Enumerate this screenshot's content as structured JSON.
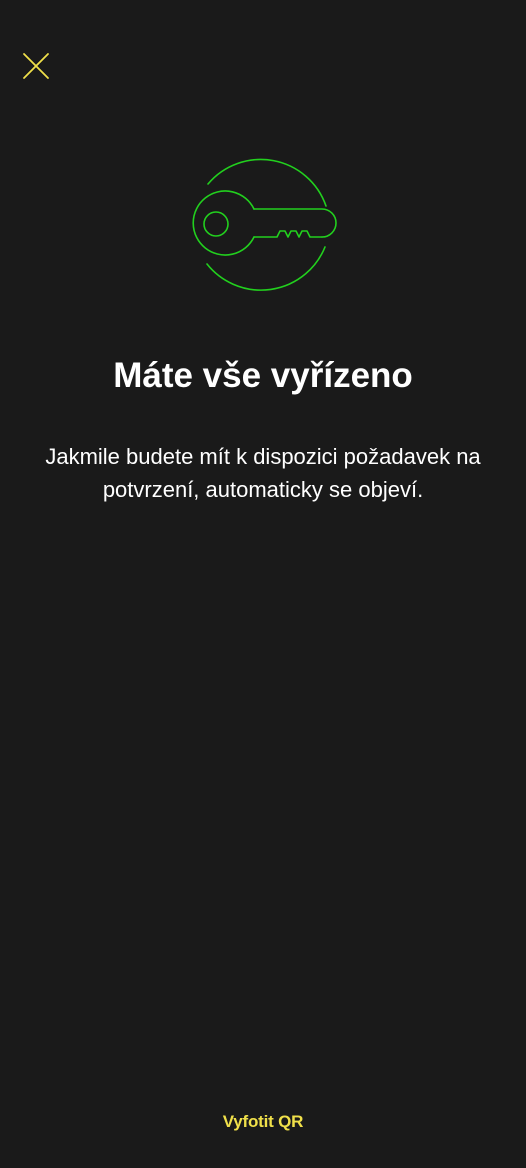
{
  "header": {
    "close_icon": "close-icon"
  },
  "illustration": {
    "icon": "key-icon"
  },
  "main": {
    "title": "Máte vše vyřízeno",
    "description": "Jakmile budete mít k dispozici požadavek na potvrzení, automaticky se objeví."
  },
  "footer": {
    "scan_qr_label": "Vyfotit QR"
  },
  "colors": {
    "background": "#1a1a1a",
    "accent_yellow": "#f0e04a",
    "accent_green": "#22d01e",
    "text": "#ffffff"
  }
}
